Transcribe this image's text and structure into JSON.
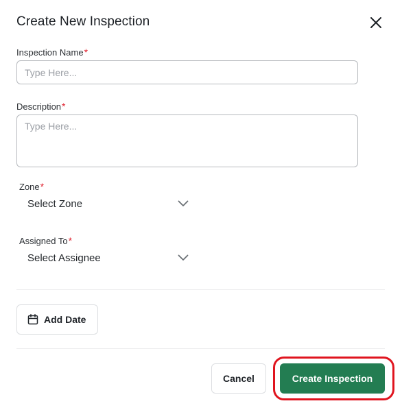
{
  "dialog": {
    "title": "Create New Inspection",
    "close_icon": "close-icon"
  },
  "fields": {
    "inspection_name": {
      "label": "Inspection Name",
      "required_mark": "*",
      "placeholder": "Type Here...",
      "value": ""
    },
    "description": {
      "label": "Description",
      "required_mark": "*",
      "placeholder": "Type Here...",
      "value": ""
    },
    "zone": {
      "label": "Zone",
      "required_mark": "*",
      "selected": "Select Zone",
      "icon": "chevron-down-icon"
    },
    "assigned_to": {
      "label": "Assigned To",
      "required_mark": "*",
      "selected": "Select Assignee",
      "icon": "chevron-down-icon"
    }
  },
  "add_date": {
    "label": "Add Date",
    "icon": "calendar-icon"
  },
  "footer": {
    "cancel_label": "Cancel",
    "create_label": "Create Inspection"
  },
  "colors": {
    "primary": "#237d52",
    "required": "#e0222f",
    "highlight": "#e0141e"
  }
}
